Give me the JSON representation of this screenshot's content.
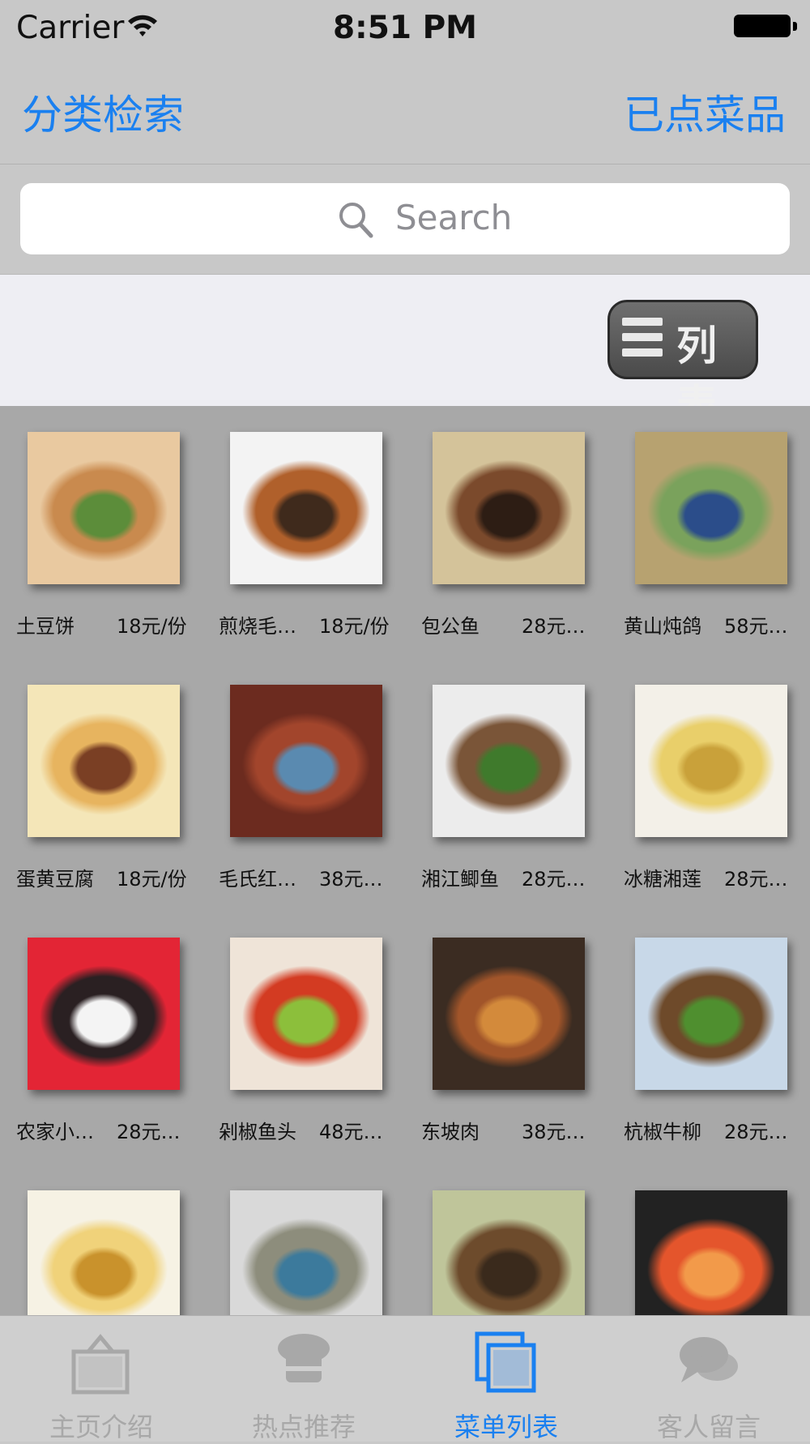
{
  "status_bar": {
    "carrier": "Carrier",
    "time": "8:51 PM"
  },
  "navbar": {
    "left_button": "分类检索",
    "right_button": "已点菜品"
  },
  "search": {
    "placeholder": "Search"
  },
  "toolbar": {
    "list_toggle_label": "列表"
  },
  "dishes": [
    {
      "name": "土豆饼",
      "price": "18元/份",
      "colors": [
        "#e9c9a0",
        "#c98a4e",
        "#5c8d3a"
      ]
    },
    {
      "name": "煎烧毛…",
      "price": "18元/份",
      "colors": [
        "#f3f3f3",
        "#b0602b",
        "#3f2a1c"
      ]
    },
    {
      "name": "包公鱼",
      "price": "28元…",
      "colors": [
        "#d4c39a",
        "#7b4a2c",
        "#2d1d14"
      ]
    },
    {
      "name": "黄山炖鸽",
      "price": "58元…",
      "colors": [
        "#b7a270",
        "#7aa25c",
        "#2b4d8a"
      ]
    },
    {
      "name": "蛋黄豆腐",
      "price": "18元/份",
      "colors": [
        "#f4e6b8",
        "#e7b45f",
        "#7a3f24"
      ]
    },
    {
      "name": "毛氏红…",
      "price": "38元…",
      "colors": [
        "#6c2b1f",
        "#a2452c",
        "#5a8ab0"
      ]
    },
    {
      "name": "湘江鲫鱼",
      "price": "28元…",
      "colors": [
        "#ececec",
        "#7a5538",
        "#3f7a2c"
      ]
    },
    {
      "name": "冰糖湘莲",
      "price": "28元…",
      "colors": [
        "#f3f0e8",
        "#e9cf6a",
        "#c9a13a"
      ]
    },
    {
      "name": "农家小…",
      "price": "28元…",
      "colors": [
        "#e32535",
        "#2a2022",
        "#f4f4f4"
      ]
    },
    {
      "name": "剁椒鱼头",
      "price": "48元…",
      "colors": [
        "#efe4d8",
        "#d33b22",
        "#8cbf3b"
      ]
    },
    {
      "name": "东坡肉",
      "price": "38元…",
      "colors": [
        "#3b2c22",
        "#a1552a",
        "#d38a3b"
      ]
    },
    {
      "name": "杭椒牛柳",
      "price": "28元…",
      "colors": [
        "#c8d8e8",
        "#6e4a2a",
        "#4f8f2f"
      ]
    },
    {
      "name": "",
      "price": "",
      "colors": [
        "#f6f2e4",
        "#f0d27a",
        "#c9922c"
      ]
    },
    {
      "name": "",
      "price": "",
      "colors": [
        "#d9d9d9",
        "#8d8d7c",
        "#3c7a9c"
      ]
    },
    {
      "name": "",
      "price": "",
      "colors": [
        "#bfc59a",
        "#6d4b2c",
        "#3a2a1c"
      ]
    },
    {
      "name": "",
      "price": "",
      "colors": [
        "#222222",
        "#e4552c",
        "#f29a4a"
      ]
    }
  ],
  "tabs": [
    {
      "label": "主页介绍",
      "icon": "home-icon",
      "active": false
    },
    {
      "label": "热点推荐",
      "icon": "chef-hat-icon",
      "active": false
    },
    {
      "label": "菜单列表",
      "icon": "menu-list-icon",
      "active": true
    },
    {
      "label": "客人留言",
      "icon": "chat-bubbles-icon",
      "active": false
    }
  ],
  "colors": {
    "accent": "#1a80f0",
    "inactive_tab": "#a8a8a8"
  }
}
